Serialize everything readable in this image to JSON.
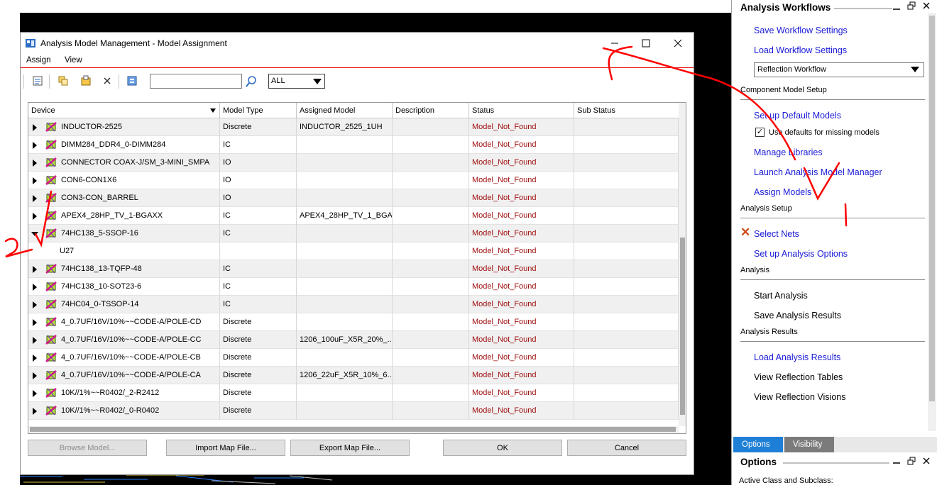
{
  "dialog": {
    "title": "Analysis Model Management - Model Assignment",
    "menu": [
      "Assign",
      "View"
    ],
    "search": {
      "value": "",
      "placeholder": ""
    },
    "filter_value": "ALL",
    "columns": [
      "Device",
      "Model Type",
      "Assigned Model",
      "Description",
      "Status",
      "Sub Status"
    ],
    "rows": [
      {
        "device": "INDUCTOR-2525",
        "type": "Discrete",
        "assigned": "INDUCTOR_2525_1UH",
        "description": "",
        "status": "Model_Not_Found",
        "sub": "",
        "expander": "closed",
        "icon": true
      },
      {
        "device": "DIMM284_DDR4_0-DIMM284",
        "type": "IC",
        "assigned": "",
        "description": "",
        "status": "Model_Not_Found",
        "sub": "",
        "expander": "closed",
        "icon": true
      },
      {
        "device": "CONNECTOR COAX-J/SM_3-MINI_SMPA",
        "type": "IO",
        "assigned": "",
        "description": "",
        "status": "Model_Not_Found",
        "sub": "",
        "expander": "closed",
        "icon": true
      },
      {
        "device": "CON6-CON1X6",
        "type": "IO",
        "assigned": "",
        "description": "",
        "status": "Model_Not_Found",
        "sub": "",
        "expander": "closed",
        "icon": true
      },
      {
        "device": "CON3-CON_BARREL",
        "type": "IO",
        "assigned": "",
        "description": "",
        "status": "Model_Not_Found",
        "sub": "",
        "expander": "closed",
        "icon": true
      },
      {
        "device": "APEX4_28HP_TV_1-BGAXX",
        "type": "IC",
        "assigned": "APEX4_28HP_TV_1_BGA...",
        "description": "",
        "status": "Model_Not_Found",
        "sub": "",
        "expander": "closed",
        "icon": true
      },
      {
        "device": "74HC138_5-SSOP-16",
        "type": "IC",
        "assigned": "",
        "description": "",
        "status": "Model_Not_Found",
        "sub": "",
        "expander": "open",
        "icon": true
      },
      {
        "device": "U27",
        "type": "",
        "assigned": "",
        "description": "",
        "status": "Model_Not_Found",
        "sub": "",
        "expander": "none",
        "icon": false
      },
      {
        "device": "74HC138_13-TQFP-48",
        "type": "IC",
        "assigned": "",
        "description": "",
        "status": "Model_Not_Found",
        "sub": "",
        "expander": "closed",
        "icon": true
      },
      {
        "device": "74HC138_10-SOT23-6",
        "type": "IC",
        "assigned": "",
        "description": "",
        "status": "Model_Not_Found",
        "sub": "",
        "expander": "closed",
        "icon": true
      },
      {
        "device": "74HC04_0-TSSOP-14",
        "type": "IC",
        "assigned": "",
        "description": "",
        "status": "Model_Not_Found",
        "sub": "",
        "expander": "closed",
        "icon": true
      },
      {
        "device": "4_0.7UF/16V/10%~~CODE-A/POLE-CD",
        "type": "Discrete",
        "assigned": "",
        "description": "",
        "status": "Model_Not_Found",
        "sub": "",
        "expander": "closed",
        "icon": true
      },
      {
        "device": "4_0.7UF/16V/10%~~CODE-A/POLE-CC",
        "type": "Discrete",
        "assigned": "1206_100uF_X5R_20%_...",
        "description": "",
        "status": "Model_Not_Found",
        "sub": "",
        "expander": "closed",
        "icon": true
      },
      {
        "device": "4_0.7UF/16V/10%~~CODE-A/POLE-CB",
        "type": "Discrete",
        "assigned": "",
        "description": "",
        "status": "Model_Not_Found",
        "sub": "",
        "expander": "closed",
        "icon": true
      },
      {
        "device": "4_0.7UF/16V/10%~~CODE-A/POLE-CA",
        "type": "Discrete",
        "assigned": "1206_22uF_X5R_10%_6...",
        "description": "",
        "status": "Model_Not_Found",
        "sub": "",
        "expander": "closed",
        "icon": true
      },
      {
        "device": "10K//1%~~R0402/_2-R2412",
        "type": "Discrete",
        "assigned": "",
        "description": "",
        "status": "Model_Not_Found",
        "sub": "",
        "expander": "closed",
        "icon": true
      },
      {
        "device": "10K//1%~~R0402/_0-R0402",
        "type": "Discrete",
        "assigned": "",
        "description": "",
        "status": "Model_Not_Found",
        "sub": "",
        "expander": "closed",
        "icon": true
      }
    ],
    "buttons": {
      "browse": "Browse Model...",
      "import": "Import Map File...",
      "export": "Export Map File...",
      "ok": "OK",
      "cancel": "Cancel"
    }
  },
  "workflows": {
    "title": "Analysis Workflows",
    "save_settings": "Save Workflow Settings",
    "load_settings": "Load Workflow Settings",
    "workflow_select": "Reflection Workflow",
    "component_section": "Component Model Setup",
    "setup_default": "Set up Default Models",
    "use_defaults": "Use defaults for missing models",
    "manage_libraries": "Manage Libraries",
    "launch_manager": "Launch Analysis Model Manager",
    "assign_models": "Assign Models",
    "analysis_setup_section": "Analysis Setup",
    "select_nets": "Select Nets",
    "setup_options": "Set up Analysis Options",
    "analysis_section": "Analysis",
    "start_analysis": "Start Analysis",
    "save_results": "Save Analysis Results",
    "results_section": "Analysis Results",
    "load_results": "Load Analysis Results",
    "view_tables": "View Reflection Tables",
    "view_visions": "View Reflection Visions"
  },
  "tabs": [
    "Options",
    "Visibility"
  ],
  "options": {
    "title": "Options",
    "active_class": "Active Class and Subclass:"
  },
  "colors": {
    "link": "#1a1ad6",
    "status": "#a01010",
    "tab_active": "#1e7fd6",
    "tab_inactive": "#7b7b7b",
    "annotation": "#ff0000"
  }
}
